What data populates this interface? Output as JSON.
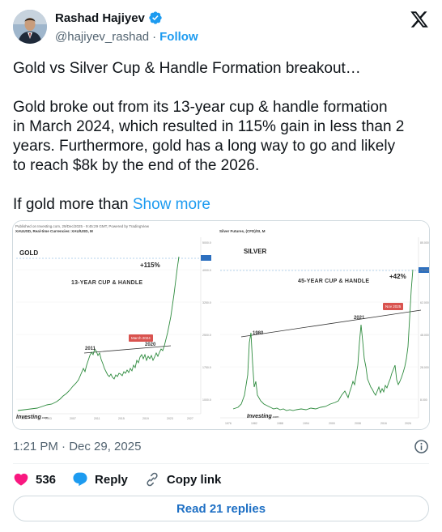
{
  "author": {
    "name": "Rashad Hajiyev",
    "handle": "@hajiyev_rashad",
    "separator": "·",
    "follow_label": "Follow"
  },
  "tweet": {
    "line1": "Gold vs Silver Cup & Handle Formation breakout…",
    "para2_l1": "Gold broke out from its 13-year cup & handle formation",
    "para2_l2": "in March 2024, which resulted in 115% gain in less than 2",
    "para2_l3": "years.  Furthermore, gold has a long way to go and likely",
    "para2_l4": "to reach $8k by the end of the 2026.",
    "para3": "If gold more than ",
    "show_more": "Show more"
  },
  "media": {
    "gold": {
      "source_line": "Published on Investing.com, 29/Dec/2025 - 9:45:29 GMT, Powered by TradingView",
      "symbol_line": "XAUUSD, Real-time Currencies: XAU/USD, M",
      "title": "GOLD",
      "subtitle": "13-YEAR CUP & HANDLE",
      "gain": "+115%",
      "label_2011": "2011",
      "label_2020": "2020",
      "callout": "March 2024",
      "brand": "Investing",
      "brand_suffix": ".com"
    },
    "silver": {
      "symbol_line": "Silver Futures, (CFD)/SI, M",
      "title": "SILVER",
      "subtitle": "45-YEAR CUP & HANDLE",
      "gain": "+42%",
      "label_1980": "1980",
      "label_2021": "2021",
      "callout": "Nov 2025",
      "brand": "Investing",
      "brand_suffix": ".com"
    }
  },
  "footer": {
    "timestamp": "1:21 PM · Dec 29, 2025",
    "like_count": "536",
    "reply_label": "Reply",
    "copy_link_label": "Copy link",
    "read_replies_label": "Read 21 replies"
  },
  "colors": {
    "accent": "#1d9bf0",
    "like": "#f91880",
    "text": "#0f1419",
    "muted": "#536471",
    "chart_line": "#2e8b3e"
  }
}
